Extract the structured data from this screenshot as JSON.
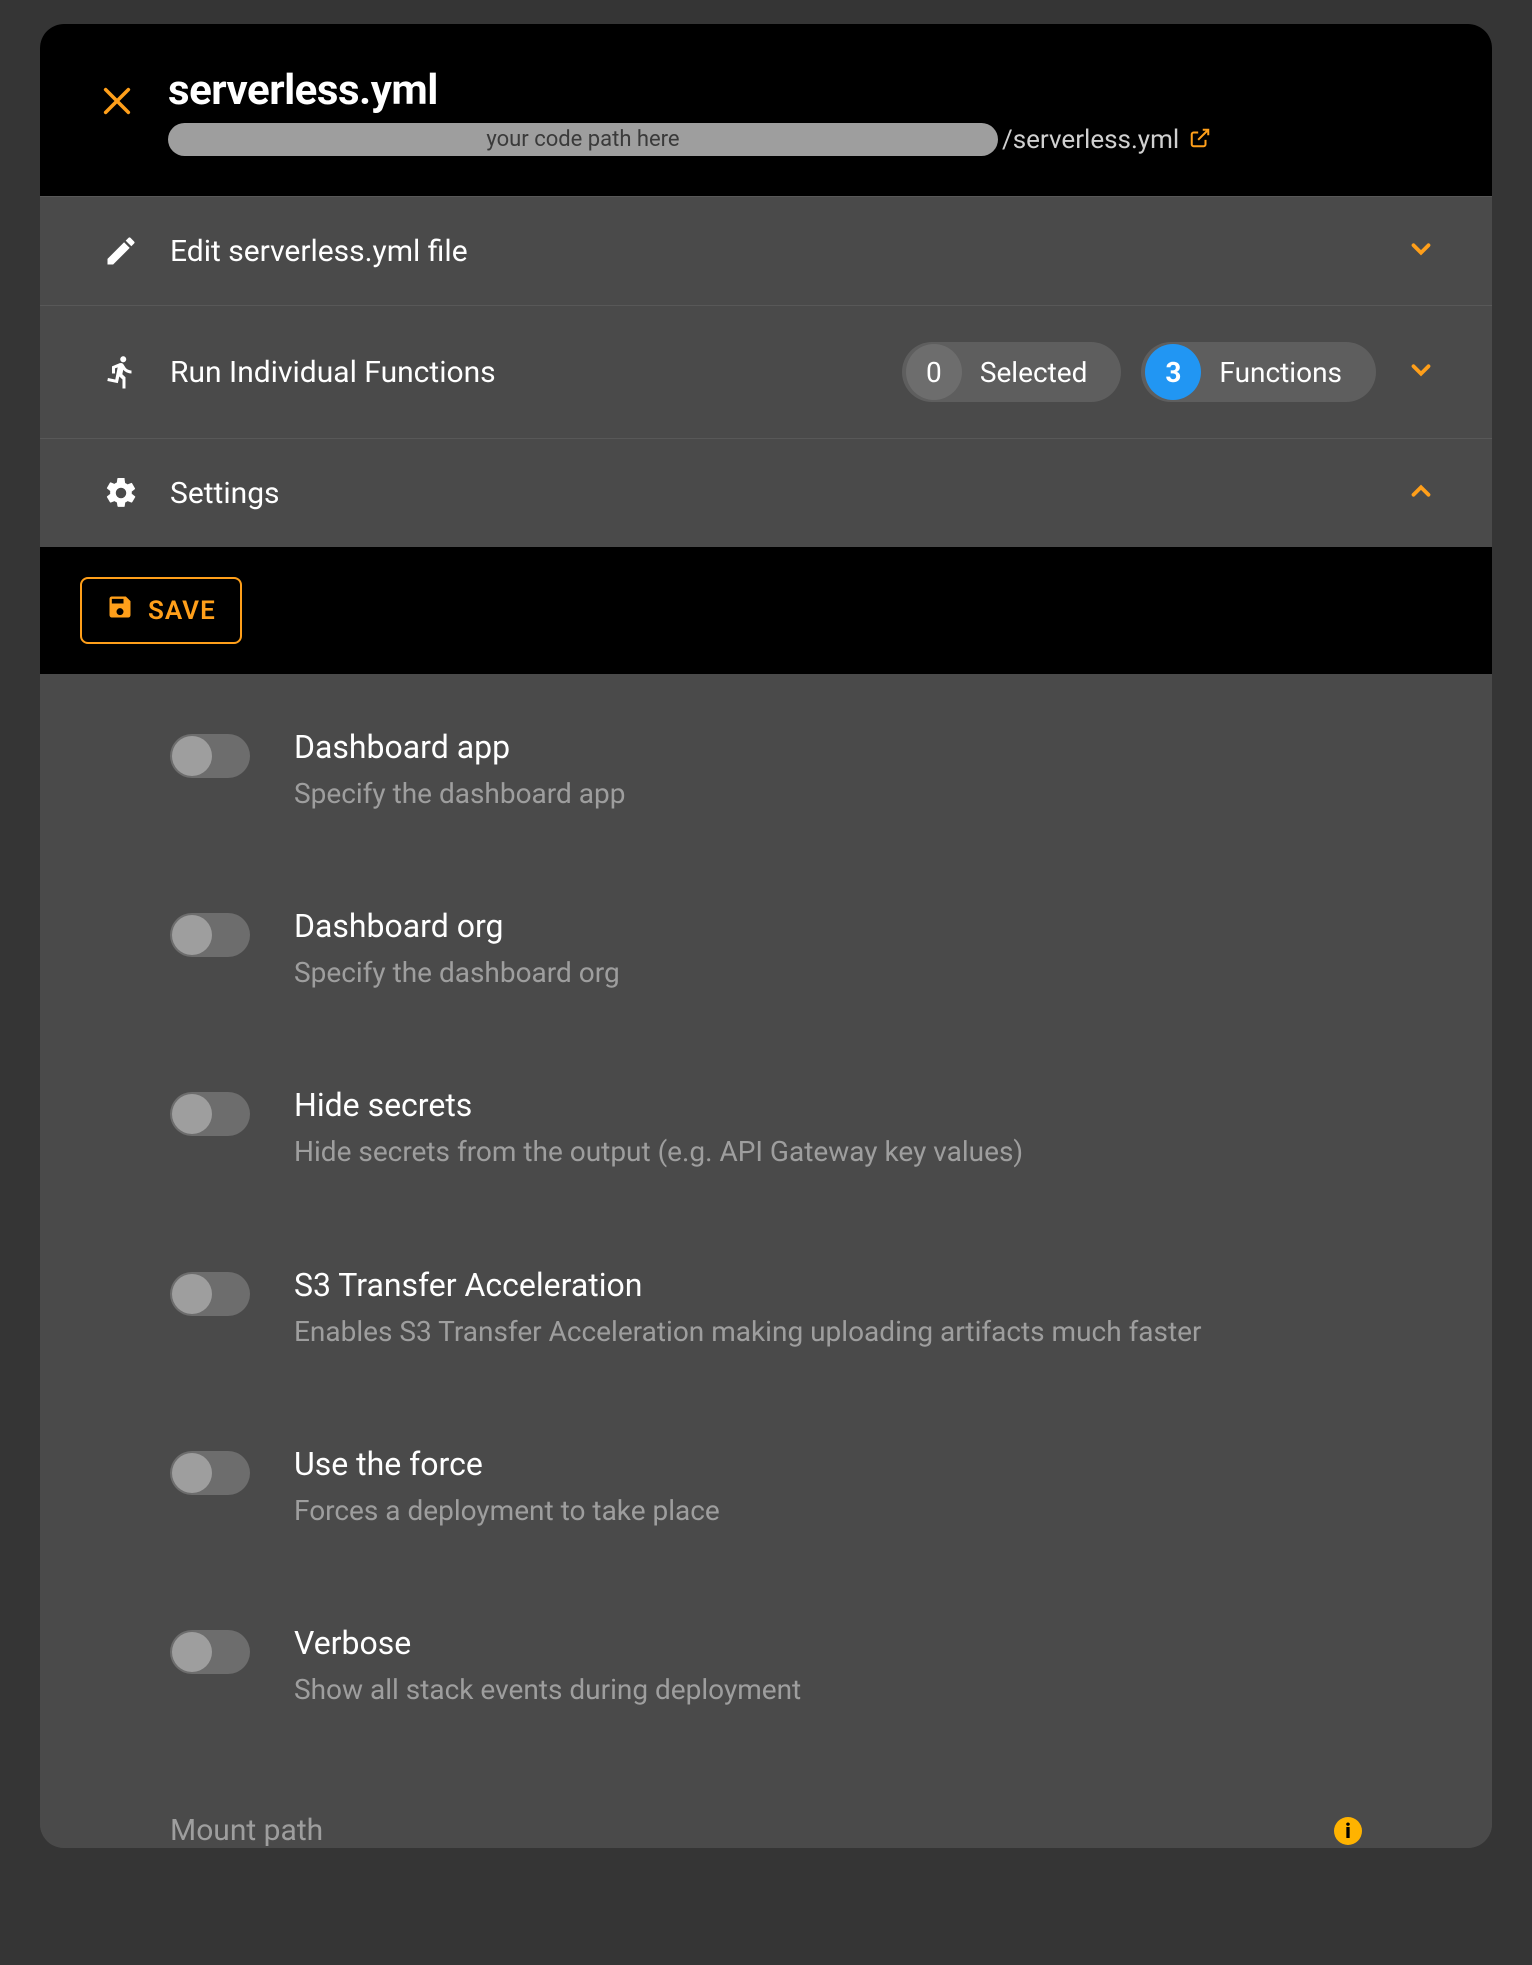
{
  "header": {
    "title": "serverless.yml",
    "path_placeholder": "your code path here",
    "path_suffix": "/serverless.yml"
  },
  "sections": {
    "edit": {
      "label": "Edit serverless.yml file"
    },
    "run": {
      "label": "Run Individual Functions",
      "selected_count": "0",
      "selected_label": "Selected",
      "functions_count": "3",
      "functions_label": "Functions"
    },
    "settings": {
      "label": "Settings"
    }
  },
  "save_button": "SAVE",
  "settings_items": [
    {
      "title": "Dashboard app",
      "desc": "Specify the dashboard app"
    },
    {
      "title": "Dashboard org",
      "desc": "Specify the dashboard org"
    },
    {
      "title": "Hide secrets",
      "desc": "Hide secrets from the output (e.g. API Gateway key values)"
    },
    {
      "title": "S3 Transfer Acceleration",
      "desc": "Enables S3 Transfer Acceleration making uploading artifacts much faster"
    },
    {
      "title": "Use the force",
      "desc": "Forces a deployment to take place"
    },
    {
      "title": "Verbose",
      "desc": "Show all stack events during deployment"
    }
  ],
  "mount_path_label": "Mount path"
}
